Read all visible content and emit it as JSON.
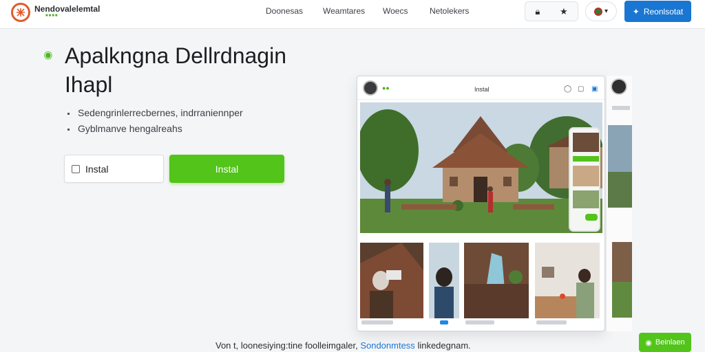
{
  "header": {
    "brand": "Nendovalelemtal",
    "nav": [
      "Doonesas",
      "Weamtares",
      "Woecs",
      "Netolekers"
    ],
    "register_label": "Reonlsotat",
    "icons": [
      "lock-icon",
      "star-icon",
      "user-avatar-icon"
    ]
  },
  "hero": {
    "title_line1": "Apalkngna Dellrdnagin",
    "title_line2": "Ihapl",
    "bullets": [
      "Sedengrinlerrecbernes, indrraniennper",
      "Gyblmanve hengalreahs"
    ],
    "checkbox_label": "Instal",
    "install_label": "Instal"
  },
  "mockup": {
    "title": "Instal"
  },
  "footer": {
    "text_before": "Von t, loonesiying:tine foolleimgaler,",
    "link_text": "Sondonmtess",
    "text_after": "linkedegnam.",
    "chat_label": "Beinlaen"
  },
  "colors": {
    "accent_green": "#52c41a",
    "accent_blue": "#1976d2",
    "logo_orange": "#e05a2b"
  }
}
